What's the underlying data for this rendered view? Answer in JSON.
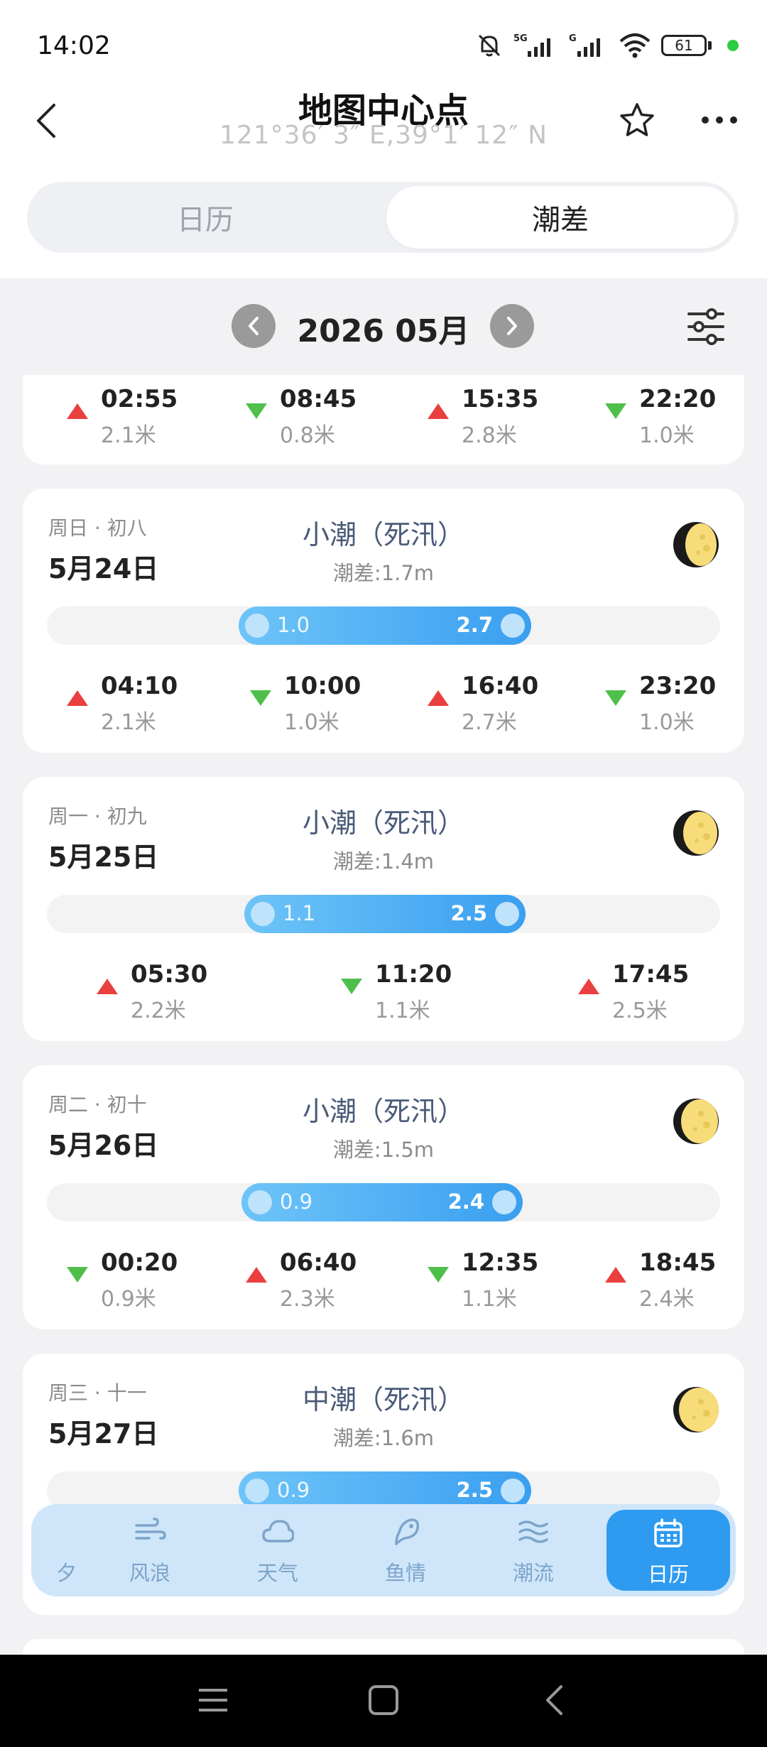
{
  "status_bar": {
    "time": "14:02",
    "network": "5G",
    "network2": "G",
    "battery": "61"
  },
  "header": {
    "title": "地图中心点",
    "coords": "121°36′ 3″ E,39°1′ 12″ N"
  },
  "tabs": [
    {
      "label": "日历",
      "selected": false
    },
    {
      "label": "潮差",
      "selected": true
    }
  ],
  "month_label": "2026 05月",
  "partial_card": {
    "tides": [
      {
        "time": "02:55",
        "height": "2.1米",
        "dir": "up"
      },
      {
        "time": "08:45",
        "height": "0.8米",
        "dir": "down"
      },
      {
        "time": "15:35",
        "height": "2.8米",
        "dir": "up"
      },
      {
        "time": "22:20",
        "height": "1.0米",
        "dir": "down"
      }
    ]
  },
  "days": [
    {
      "meta": "周日 · 初八",
      "date": "5月24日",
      "tide_type": "小潮（死汛）",
      "tide_diff": "潮差:1.7m",
      "range": {
        "low": "1.0",
        "high": "2.7",
        "low_value": 1.0,
        "high_value": 2.7
      },
      "tides": [
        {
          "time": "04:10",
          "height": "2.1米",
          "dir": "up"
        },
        {
          "time": "10:00",
          "height": "1.0米",
          "dir": "down"
        },
        {
          "time": "16:40",
          "height": "2.7米",
          "dir": "up"
        },
        {
          "time": "23:20",
          "height": "1.0米",
          "dir": "down"
        }
      ]
    },
    {
      "meta": "周一 · 初九",
      "date": "5月25日",
      "tide_type": "小潮（死汛）",
      "tide_diff": "潮差:1.4m",
      "range": {
        "low": "1.1",
        "high": "2.5",
        "low_value": 1.1,
        "high_value": 2.5
      },
      "tides": [
        {
          "time": "05:30",
          "height": "2.2米",
          "dir": "up"
        },
        {
          "time": "11:20",
          "height": "1.1米",
          "dir": "down"
        },
        {
          "time": "17:45",
          "height": "2.5米",
          "dir": "up"
        }
      ]
    },
    {
      "meta": "周二 · 初十",
      "date": "5月26日",
      "tide_type": "小潮（死汛）",
      "tide_diff": "潮差:1.5m",
      "range": {
        "low": "0.9",
        "high": "2.4",
        "low_value": 0.9,
        "high_value": 2.4
      },
      "tides": [
        {
          "time": "00:20",
          "height": "0.9米",
          "dir": "down"
        },
        {
          "time": "06:40",
          "height": "2.3米",
          "dir": "up"
        },
        {
          "time": "12:35",
          "height": "1.1米",
          "dir": "down"
        },
        {
          "time": "18:45",
          "height": "2.4米",
          "dir": "up"
        }
      ]
    },
    {
      "meta": "周三 · 十一",
      "date": "5月27日",
      "tide_type": "中潮（死汛）",
      "tide_diff": "潮差:1.6m",
      "range": {
        "low": "0.9",
        "high": "2.5",
        "low_value": 0.9,
        "high_value": 2.5
      },
      "tides": []
    }
  ],
  "bottom_nav": [
    {
      "label": "夕",
      "icon": "moon-icon",
      "active": false
    },
    {
      "label": "风浪",
      "icon": "wind-icon",
      "active": false
    },
    {
      "label": "天气",
      "icon": "cloud-icon",
      "active": false
    },
    {
      "label": "鱼情",
      "icon": "fish-icon",
      "active": false
    },
    {
      "label": "潮流",
      "icon": "wave-icon",
      "active": false
    },
    {
      "label": "日历",
      "icon": "calendar-icon",
      "active": true
    }
  ],
  "colors": {
    "accent": "#2e9bf0",
    "tide_up": "#ea3f3f",
    "tide_down": "#4fbf4b",
    "tide_type_text": "#4a5a78"
  }
}
